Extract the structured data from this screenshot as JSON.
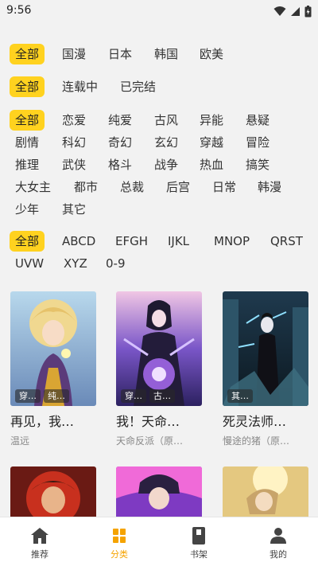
{
  "status_bar": {
    "time": "9:56"
  },
  "filters": {
    "region": [
      "全部",
      "国漫",
      "日本",
      "韩国",
      "欧美"
    ],
    "status": [
      "全部",
      "连载中",
      "已完结"
    ],
    "genre_row1": [
      "全部",
      "恋爱",
      "纯爱",
      "古风",
      "异能",
      "悬疑"
    ],
    "genre_row2": [
      "剧情",
      "科幻",
      "奇幻",
      "玄幻",
      "穿越",
      "冒险"
    ],
    "genre_row3": [
      "推理",
      "武侠",
      "格斗",
      "战争",
      "热血",
      "搞笑"
    ],
    "genre_row4": [
      "大女主",
      "都市",
      "总裁",
      "后宫",
      "日常",
      "韩漫"
    ],
    "genre_row5": [
      "少年",
      "其它"
    ],
    "letter_row1": [
      "全部",
      "ABCD",
      "EFGH",
      "IJKL",
      "MNOP",
      "QRST"
    ],
    "letter_row2": [
      "UVW",
      "XYZ",
      "0-9"
    ]
  },
  "comics": [
    {
      "title": "再见，我…",
      "author": "温远",
      "tags": [
        "穿…",
        "纯…"
      ]
    },
    {
      "title": "我！天命…",
      "author": "天命反派（原…",
      "tags": [
        "穿…",
        "古…"
      ]
    },
    {
      "title": "死灵法师…",
      "author": "慢途的猪（原…",
      "tags": [
        "其…",
        ""
      ]
    }
  ],
  "nav": {
    "recommend": "推荐",
    "category": "分类",
    "bookshelf": "书架",
    "mine": "我的"
  },
  "colors": {
    "accent": "#ffd21f",
    "nav_active": "#f5a300"
  }
}
